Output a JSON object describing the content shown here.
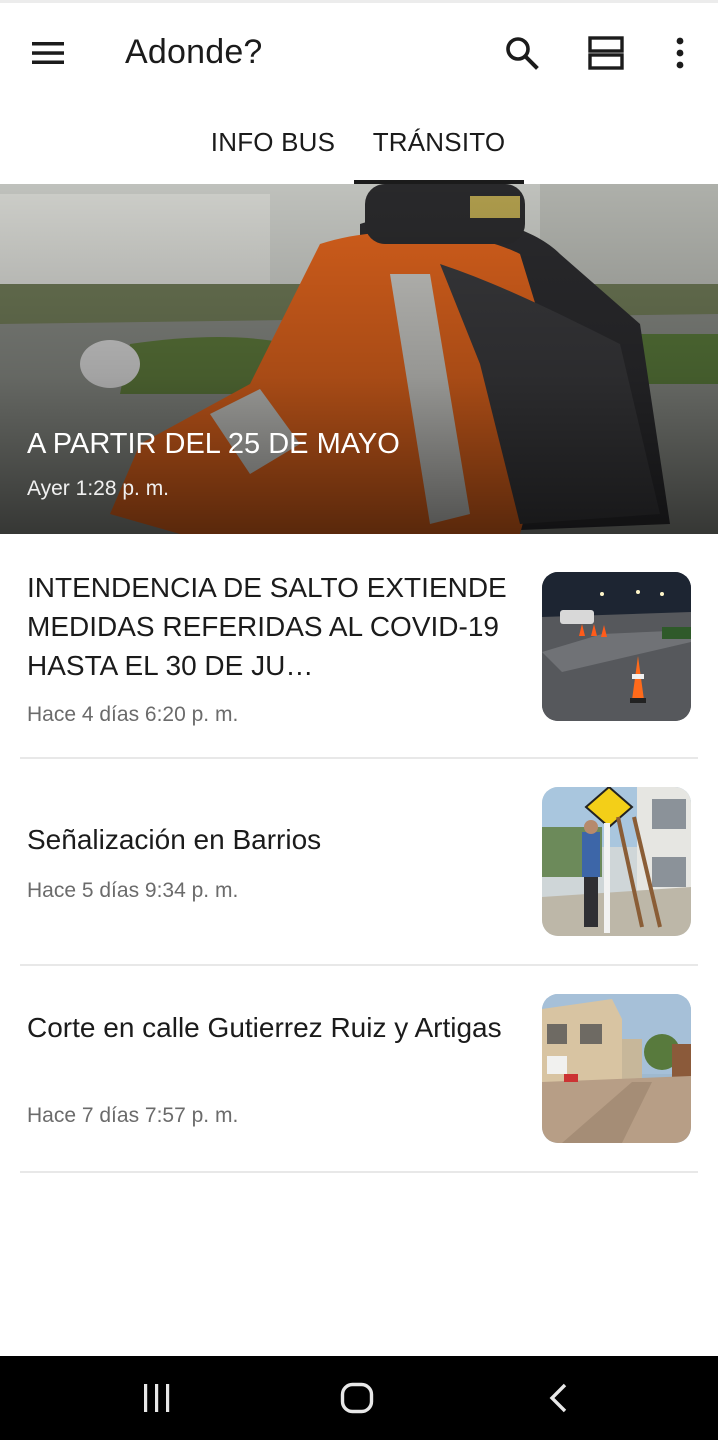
{
  "app": {
    "title": "Adonde?",
    "icons": {
      "menu": "hamburger-menu-icon",
      "search": "search-icon",
      "layout": "view-layout-icon",
      "more": "more-vertical-icon"
    }
  },
  "tabs": [
    {
      "label": "INFO BUS",
      "selected": false
    },
    {
      "label": "TRÁNSITO",
      "selected": true
    }
  ],
  "featured": {
    "title": "A PARTIR DEL 25 DE MAYO",
    "time": "Ayer 1:28 p. m."
  },
  "news": [
    {
      "title": "INTENDENCIA DE SALTO EXTIENDE MEDIDAS REFERIDAS AL COVID-19 HASTA EL 30 DE JU…",
      "time": "Hace 4 días 6:20 p. m."
    },
    {
      "title": "Señalización en Barrios",
      "time": "Hace 5 días 9:34 p. m."
    },
    {
      "title": "Corte en calle Gutierrez Ruiz y Artigas",
      "time": "Hace 7 días 7:57 p. m."
    }
  ],
  "system_nav": {
    "icons": [
      "recent-apps-icon",
      "home-icon",
      "back-icon"
    ]
  },
  "colors": {
    "tab_indicator": "#1b1b1b",
    "nav_bar": "#000000",
    "secondary_text": "#6b6b6b"
  }
}
